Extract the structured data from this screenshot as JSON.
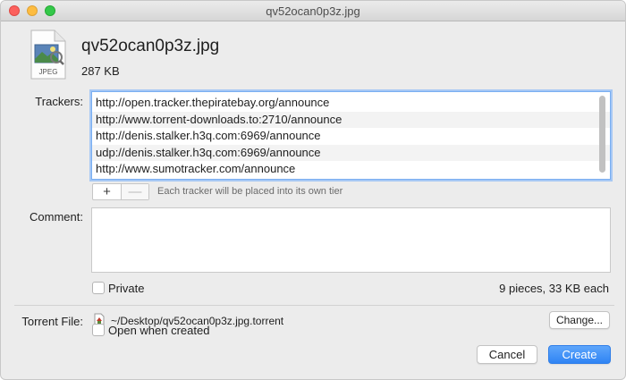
{
  "window": {
    "title": "qv52ocan0p3z.jpg"
  },
  "file": {
    "name": "qv52ocan0p3z.jpg",
    "size": "287 KB",
    "icon_label": "JPEG",
    "icon": "jpeg-file-icon"
  },
  "trackers": {
    "label": "Trackers:",
    "items": [
      "http://open.tracker.thepiratebay.org/announce",
      "http://www.torrent-downloads.to:2710/announce",
      "http://denis.stalker.h3q.com:6969/announce",
      "udp://denis.stalker.h3q.com:6969/announce",
      "http://www.sumotracker.com/announce"
    ],
    "add_label": "+",
    "remove_label": "—",
    "hint": "Each tracker will be placed into its own tier"
  },
  "comment": {
    "label": "Comment:",
    "value": ""
  },
  "private": {
    "label": "Private",
    "checked": false
  },
  "pieces_info": "9 pieces, 33 KB each",
  "torrent_file": {
    "label": "Torrent File:",
    "path": "~/Desktop/qv52ocan0p3z.jpg.torrent",
    "change_label": "Change..."
  },
  "open_when_created": {
    "label": "Open when created",
    "checked": false
  },
  "buttons": {
    "cancel": "Cancel",
    "create": "Create"
  },
  "colors": {
    "accent": "#2f84f4",
    "focus_ring": "#79aef2"
  }
}
